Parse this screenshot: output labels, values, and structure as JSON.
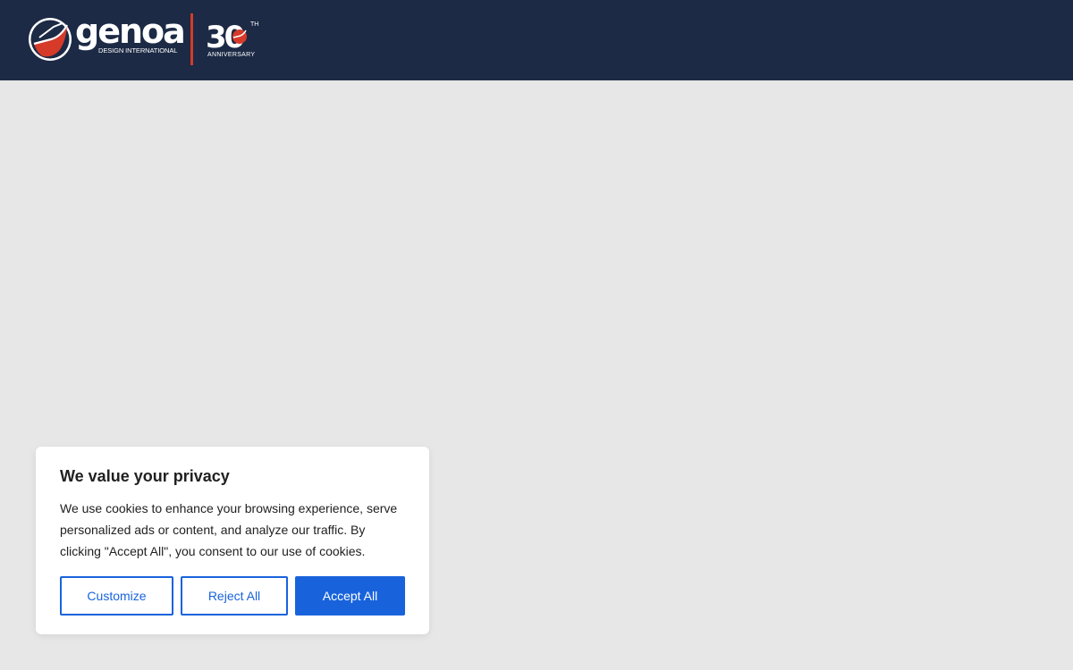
{
  "header": {
    "logo": {
      "wordmark": "genoa",
      "subtitle": "DESIGN INTERNATIONAL",
      "anniversary_number": "30",
      "anniversary_suffix": "TH",
      "anniversary_label": "ANNIVERSARY"
    },
    "colors": {
      "background": "#1c2a45",
      "accent": "#d63a29"
    }
  },
  "main": {
    "background": "#e7e7e7"
  },
  "cookie_banner": {
    "title": "We value your privacy",
    "description": "We use cookies to enhance your browsing experience, serve personalized ads or content, and analyze our traffic. By clicking \"Accept All\", you consent to our use of cookies.",
    "buttons": {
      "customize": "Customize",
      "reject": "Reject All",
      "accept": "Accept All"
    },
    "colors": {
      "primary": "#1863dc",
      "text": "#212121"
    }
  }
}
